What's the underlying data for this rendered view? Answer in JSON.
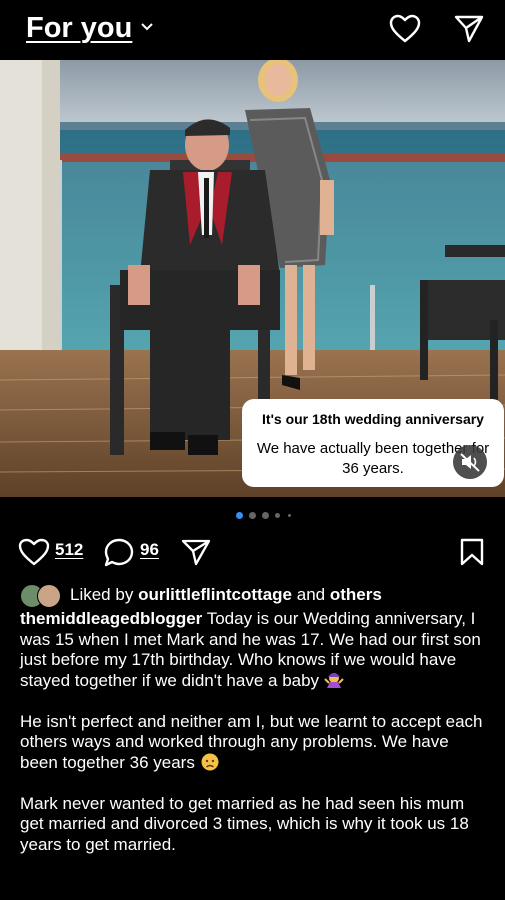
{
  "header": {
    "title": "For you"
  },
  "post_card": {
    "title": "It's our 18th wedding anniversary",
    "body": "We have actually been together for 36 years."
  },
  "carousel": {
    "total_dots": 5,
    "active_index": 0
  },
  "actions": {
    "likes": "512",
    "comments": "96"
  },
  "liked_by": {
    "prefix": "Liked by",
    "user": "ourlittleflintcottage",
    "suffix": "others",
    "joiner": "and"
  },
  "caption": {
    "username": "themiddleagedblogger",
    "para1": "Today is our Wedding anniversary, I was 15 when I met Mark and he was 17. We had our first son just before my 17th birthday. Who knows if we would have stayed together if we didn't have a baby",
    "para2": "He isn't perfect and neither am I, but we learnt to accept each others ways and worked through any problems. We have been together 36 years",
    "para3": "Mark never wanted to get married as he had seen his mum get married and divorced 3 times, which is why it took us 18 years to get married."
  },
  "colors": {
    "background": "#000000",
    "text": "#ffffff",
    "active_dot": "#3a8ff5",
    "card": "#ffffff"
  },
  "icons": [
    "chevron-down-icon",
    "heart-icon",
    "send-icon",
    "comment-icon",
    "bookmark-icon",
    "mute-icon",
    "woman-shrugging-emoji",
    "sad-face-emoji"
  ]
}
